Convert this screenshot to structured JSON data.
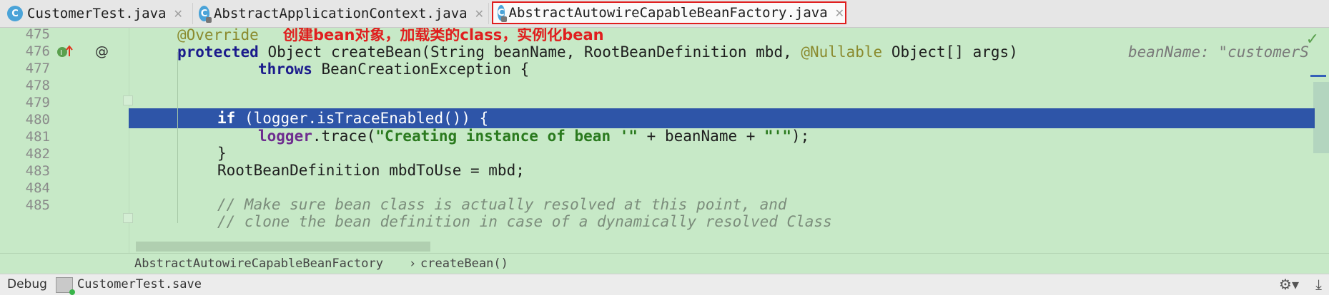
{
  "tabs": [
    {
      "label": "CustomerTest.java",
      "icon": "C",
      "active": false
    },
    {
      "label": "AbstractApplicationContext.java",
      "icon": "C",
      "active": false
    },
    {
      "label": "AbstractAutowireCapableBeanFactory.java",
      "icon": "C",
      "active": true
    }
  ],
  "tab_close_glyph": "✕",
  "editor": {
    "line_numbers": [
      "475",
      "476",
      "477",
      "478",
      "479",
      "480",
      "481",
      "482",
      "483",
      "484",
      "485"
    ],
    "l475_annotation": "@Override",
    "l475_chinese_note": "创建bean对象，加载类的class，实例化bean",
    "l476_kw": "protected",
    "l476_a": " Object createBean(String beanName, RootBeanDefinition mbd, ",
    "l476_ann": "@Nullable",
    "l476_b": " Object[] args)",
    "l476_hint": "beanName: \"customerS",
    "l477_kw": "throws",
    "l477_rest": " BeanCreationException {",
    "l479_kw": "if",
    "l479_rest": " (logger.isTraceEnabled()) {",
    "l480_ident": "logger",
    "l480_a": ".trace(",
    "l480_str": "\"Creating instance of bean '\"",
    "l480_b": " + beanName + ",
    "l480_str2": "\"'\"",
    "l480_c": ");",
    "l481": "}",
    "l482": "RootBeanDefinition mbdToUse = mbd;",
    "l484": "// Make sure bean class is actually resolved at this point, and",
    "l485": "// clone the bean definition in case of a dynamically resolved Class",
    "gutter_at": "@"
  },
  "breadcrumb": {
    "class_name": "AbstractAutowireCapableBeanFactory",
    "separator": "›",
    "method": "createBean()"
  },
  "debug": {
    "label": "Debug",
    "config": "CustomerTest.save"
  },
  "colors": {
    "editor_bg": "#c7e9c7",
    "highlight": "#2e55a8",
    "annotation_red": "#e01e1e",
    "active_tab_border": "#e01e1e"
  }
}
